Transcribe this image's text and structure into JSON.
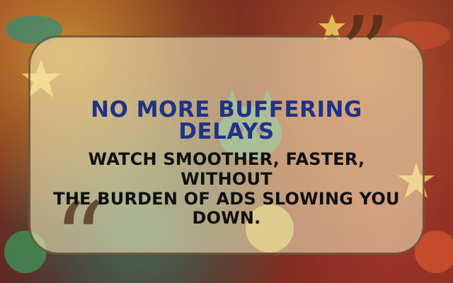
{
  "headline": "NO MORE BUFFERING DELAYS",
  "message_lines": [
    "WATCH SMOOTHER, FASTER, WITHOUT",
    "THE BURDEN OF ADS SLOWING YOU DOWN."
  ],
  "colors": {
    "headline": "#1f3387",
    "body_text": "#111111",
    "card": "#f5ecbc"
  }
}
